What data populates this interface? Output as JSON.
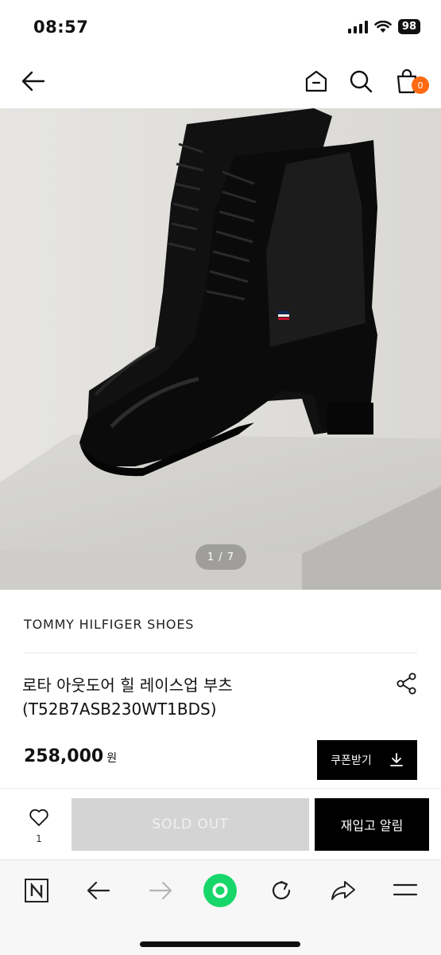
{
  "status_bar": {
    "time": "08:57",
    "battery": "98"
  },
  "header": {
    "cart_count": "0"
  },
  "product": {
    "image_counter": "1 / 7",
    "brand": "TOMMY HILFIGER SHOES",
    "name_line1": "로타 아웃도어 힐 레이스업 부츠",
    "name_line2": "(T52B7ASB230WT1BDS)",
    "price": "258,000",
    "currency": "원"
  },
  "coupon_button": {
    "label": "쿠폰받기"
  },
  "actions": {
    "wish_count": "1",
    "sold_out_label": "SOLD OUT",
    "restock_label": "재입고 알림"
  },
  "icons": {
    "back": "arrow-left-icon",
    "home": "home-icon",
    "search": "search-icon",
    "cart": "shopping-bag-icon",
    "share": "share-icon",
    "download": "download-icon",
    "heart": "heart-icon",
    "naver": "naver-n-icon",
    "browser_back": "arrow-left-icon",
    "browser_forward": "arrow-right-icon",
    "green_dot": "green-circle-icon",
    "reload": "reload-icon",
    "browser_share": "share-arrow-icon",
    "menu": "menu-icon"
  },
  "colors": {
    "accent_orange": "#ff6a13",
    "green": "#17d76a",
    "sold_out_bg": "#d4d4d4",
    "black": "#000000"
  }
}
